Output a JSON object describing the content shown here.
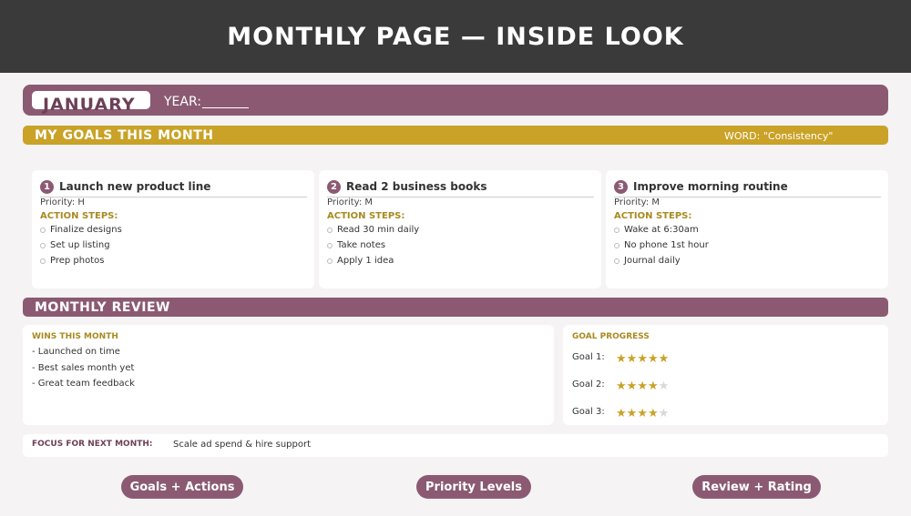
{
  "header": {
    "title": "MONTHLY PAGE — INSIDE LOOK"
  },
  "month": {
    "name": "JANUARY",
    "year_label": "YEAR:"
  },
  "goals_section": {
    "title": "MY GOALS THIS MONTH",
    "word": "WORD: \"Consistency\""
  },
  "goals": [
    {
      "num": "1",
      "title": "Launch new product line",
      "priority": "Priority: H",
      "steps_label": "ACTION STEPS:",
      "steps": [
        "Finalize designs",
        "Set up listing",
        "Prep photos"
      ]
    },
    {
      "num": "2",
      "title": "Read 2 business books",
      "priority": "Priority: M",
      "steps_label": "ACTION STEPS:",
      "steps": [
        "Read 30 min daily",
        "Take notes",
        "Apply 1 idea"
      ]
    },
    {
      "num": "3",
      "title": "Improve morning routine",
      "priority": "Priority: M",
      "steps_label": "ACTION STEPS:",
      "steps": [
        "Wake at 6:30am",
        "No phone 1st hour",
        "Journal daily"
      ]
    }
  ],
  "review": {
    "title": "MONTHLY REVIEW",
    "wins_label": "WINS THIS MONTH",
    "wins": [
      "- Launched on time",
      "- Best sales month yet",
      "- Great team feedback"
    ],
    "progress_label": "GOAL PROGRESS",
    "progress": [
      {
        "label": "Goal 1:",
        "rating": 5,
        "max": 5
      },
      {
        "label": "Goal 2:",
        "rating": 4,
        "max": 5
      },
      {
        "label": "Goal 3:",
        "rating": 4,
        "max": 5
      }
    ]
  },
  "focus": {
    "label": "FOCUS FOR NEXT MONTH:",
    "value": "Scale ad spend & hire support"
  },
  "pills": [
    "Goals + Actions",
    "Priority Levels",
    "Review + Rating"
  ],
  "colors": {
    "accent": "#8b5a72",
    "gold": "#c9a227",
    "dark": "#3a3a3a"
  }
}
